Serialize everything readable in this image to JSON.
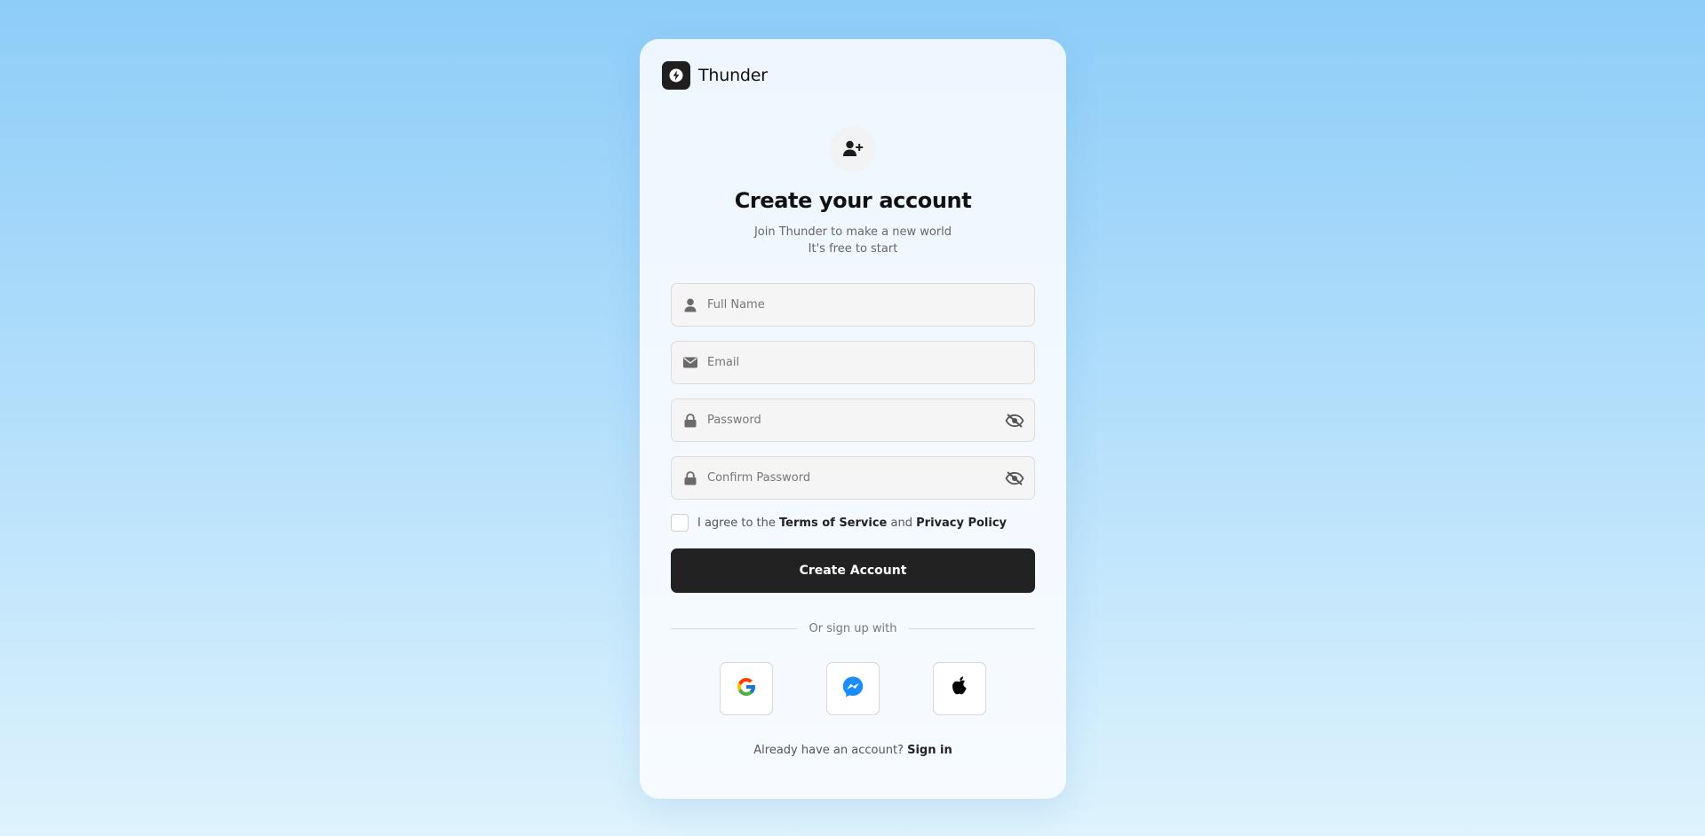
{
  "brand": {
    "name": "Thunder",
    "logo_icon": "lightning-bolt-icon"
  },
  "header": {
    "badge_icon": "user-plus-icon",
    "title": "Create your account",
    "subtitle_line1": "Join Thunder to make a new world",
    "subtitle_line2": "It's free to start"
  },
  "form": {
    "full_name": {
      "placeholder": "Full Name",
      "value": "",
      "icon": "user-icon"
    },
    "email": {
      "placeholder": "Email",
      "value": "",
      "icon": "envelope-icon"
    },
    "password": {
      "placeholder": "Password",
      "value": "",
      "icon": "lock-icon",
      "toggle_icon": "eye-slash-icon"
    },
    "confirm_password": {
      "placeholder": "Confirm Password",
      "value": "",
      "icon": "lock-icon",
      "toggle_icon": "eye-slash-icon"
    },
    "agree": {
      "checked": false,
      "prefix": "I agree to the",
      "terms_label": "Terms of Service",
      "and": "and",
      "privacy_label": "Privacy Policy"
    },
    "submit_label": "Create Account"
  },
  "social": {
    "divider_label": "Or sign up with",
    "providers": [
      "google-icon",
      "messenger-icon",
      "apple-icon"
    ]
  },
  "footer": {
    "prompt": "Already have an account?",
    "signin_label": "Sign in"
  },
  "colors": {
    "primary": "#222222",
    "background_top": "#8ecdf8",
    "background_bottom": "#def3fd",
    "messenger": "#1a8cff"
  }
}
